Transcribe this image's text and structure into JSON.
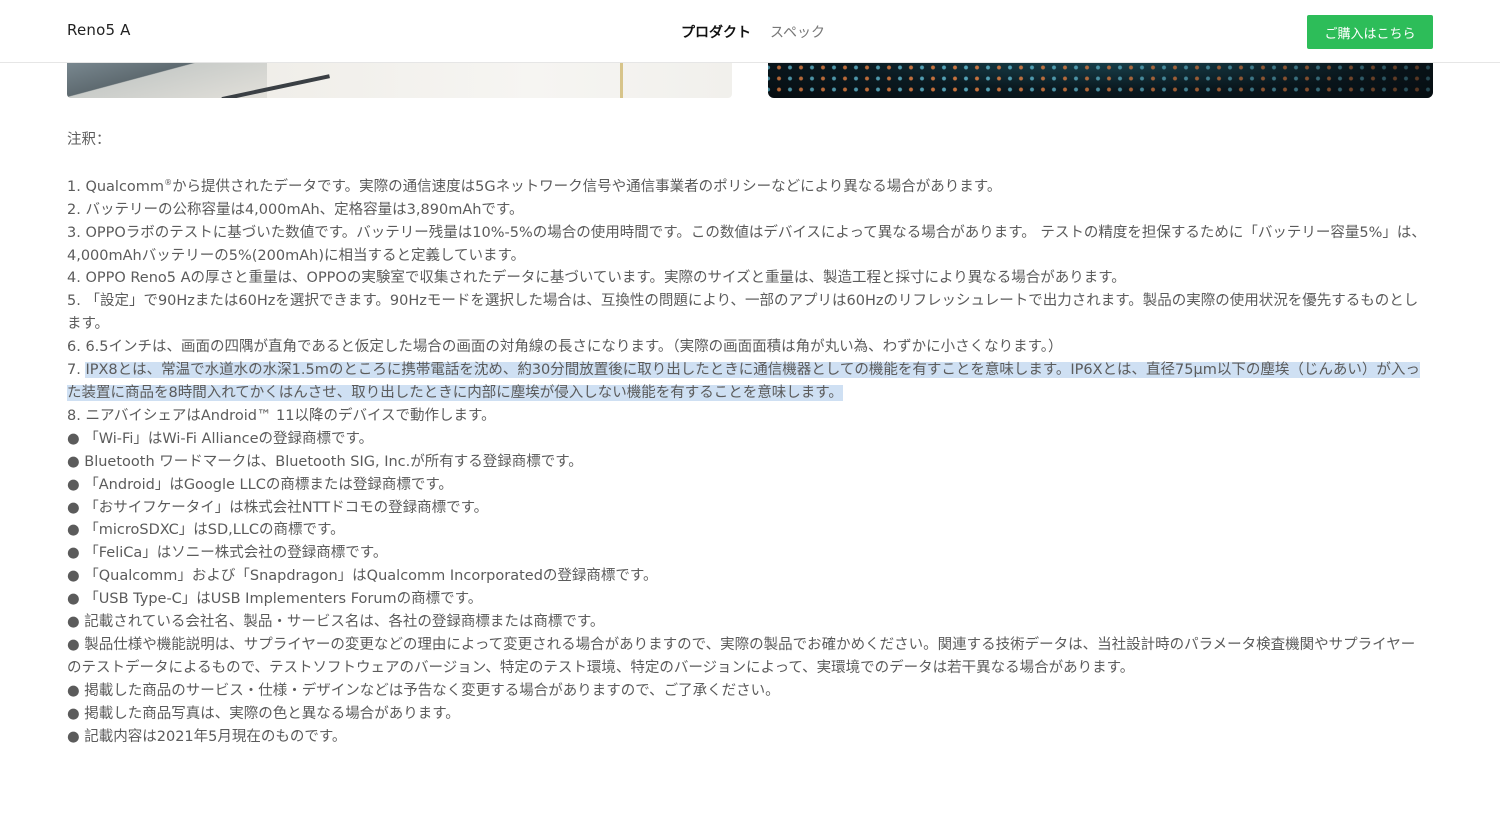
{
  "header": {
    "brand": "Reno5 A",
    "nav": {
      "product": "プロダクト",
      "spec": "スペック"
    },
    "buy_label": "ご購入はこちら"
  },
  "notes": {
    "title": "注釈：",
    "lines": [
      {
        "pre": "1. Qualcomm",
        "sup": "®",
        "post": "から提供されたデータです。実際の通信速度は5Gネットワーク信号や通信事業者のポリシーなどにより異なる場合があります。"
      },
      {
        "text": "2. バッテリーの公称容量は4,000mAh、定格容量は3,890mAhです。"
      },
      {
        "text": "3. OPPOラボのテストに基づいた数値です。バッテリー残量は10%-5%の場合の使用時間です。この数値はデバイスによって異なる場合があります。 テストの精度を担保するために「バッテリー容量5%」は、"
      },
      {
        "text": "4,000mAhバッテリーの5%(200mAh)に相当すると定義しています。"
      },
      {
        "text": "4. OPPO Reno5 Aの厚さと重量は、OPPOの実験室で収集されたデータに基づいています。実際のサイズと重量は、製造工程と採寸により異なる場合があります。"
      },
      {
        "text": "5. 「設定」で90Hzまたは60Hzを選択できます。90Hzモードを選択した場合は、互換性の問題により、一部のアプリは60Hzのリフレッシュレートで出力されます。製品の実際の使用状況を優先するものとし"
      },
      {
        "text": "ます。"
      },
      {
        "text": "6. 6.5インチは、画面の四隅が直角であると仮定した場合の画面の対角線の長さになります。（実際の画面面積は角が丸い為、わずかに小さくなります。）"
      },
      {
        "pre": "7. ",
        "hl": "IPX8とは、常温で水道水の水深1.5mのところに携帯電話を沈め、約30分間放置後に取り出したときに通信機器としての機能を有すことを意味します。IP6Xとは、直径75μm以下の塵埃（じんあい）が入っ"
      },
      {
        "hl": "た装置に商品を8時間入れてかくはんさせ、取り出したときに内部に塵埃が侵入しない機能を有することを意味します。"
      },
      {
        "text": "8. ニアバイシェアはAndroid™ 11以降のデバイスで動作します。"
      },
      {
        "text": "● 「Wi-Fi」はWi-Fi Allianceの登録商標です。"
      },
      {
        "text": "● Bluetooth ワードマークは、Bluetooth SIG, Inc.が所有する登録商標です。"
      },
      {
        "text": "● 「Android」はGoogle LLCの商標または登録商標です。"
      },
      {
        "text": "● 「おサイフケータイ」は株式会社NTTドコモの登録商標です。"
      },
      {
        "text": "● 「microSDXC」はSD,LLCの商標です。"
      },
      {
        "text": "● 「FeliCa」はソニー株式会社の登録商標です。"
      },
      {
        "text": "● 「Qualcomm」および「Snapdragon」はQualcomm Incorporatedの登録商標です。"
      },
      {
        "text": "● 「USB Type-C」はUSB Implementers Forumの商標です。"
      },
      {
        "text": "● 記載されている会社名、製品・サービス名は、各社の登録商標または商標です。"
      },
      {
        "text": "● 製品仕様や機能説明は、サプライヤーの変更などの理由によって変更される場合がありますので、実際の製品でお確かめください。関連する技術データは、当社設計時のパラメータ検査機関やサプライヤー"
      },
      {
        "text": "のテストデータによるもので、テストソフトウェアのバージョン、特定のテスト環境、特定のバージョンによって、実環境でのデータは若干異なる場合があります。"
      },
      {
        "text": "● 掲載した商品のサービス・仕様・デザインなどは予告なく変更する場合がありますので、ご了承ください。"
      },
      {
        "text": "● 掲載した商品写真は、実際の色と異なる場合があります。"
      },
      {
        "text": "● 記載内容は2021年5月現在のものです。"
      }
    ]
  }
}
